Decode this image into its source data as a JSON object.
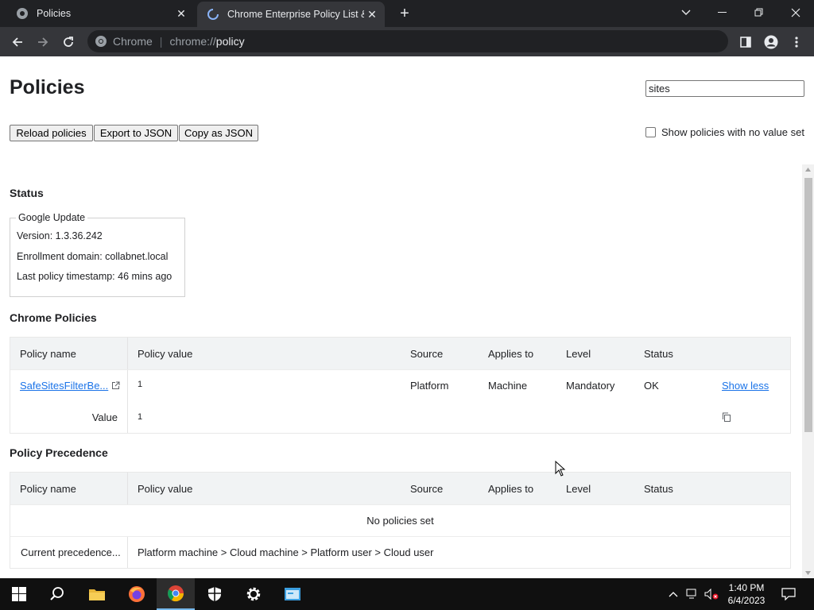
{
  "tabs": [
    {
      "title": "Policies",
      "active": false
    },
    {
      "title": "Chrome Enterprise Policy List & M",
      "active": true
    }
  ],
  "toolbar": {
    "site_chip": "Chrome",
    "url_prefix": "chrome://",
    "url_host": "policy"
  },
  "page": {
    "title": "Policies",
    "search_value": "sites",
    "buttons": {
      "reload": "Reload policies",
      "export": "Export to JSON",
      "copy": "Copy as JSON"
    },
    "show_unset_label": "Show policies with no value set",
    "show_unset_checked": false
  },
  "status": {
    "heading": "Status",
    "legend": "Google Update",
    "version": "Version: 1.3.36.242",
    "enrollment": "Enrollment domain: collabnet.local",
    "timestamp": "Last policy timestamp: 46 mins ago"
  },
  "chrome_policies": {
    "heading": "Chrome Policies",
    "headers": [
      "Policy name",
      "Policy value",
      "Source",
      "Applies to",
      "Level",
      "Status"
    ],
    "row": {
      "name": "SafeSitesFilterBe...",
      "value": "1",
      "source": "Platform",
      "applies_to": "Machine",
      "level": "Mandatory",
      "status": "OK",
      "toggle": "Show less"
    },
    "value_row": {
      "label": "Value",
      "value": "1"
    }
  },
  "precedence": {
    "heading": "Policy Precedence",
    "headers": [
      "Policy name",
      "Policy value",
      "Source",
      "Applies to",
      "Level",
      "Status"
    ],
    "empty": "No policies set",
    "current_label": "Current precedence...",
    "current_value": "Platform machine > Cloud machine > Platform user > Cloud user"
  },
  "taskbar": {
    "time": "1:40 PM",
    "date": "6/4/2023",
    "items": [
      "windows-start",
      "search",
      "file-explorer",
      "firefox",
      "chrome",
      "windows-security",
      "settings",
      "remote-desktop"
    ]
  },
  "colors": {
    "link": "#1a73e8",
    "tab_bg": "#202124",
    "toolbar_bg": "#35363a",
    "taskbar_bg": "#101010"
  }
}
